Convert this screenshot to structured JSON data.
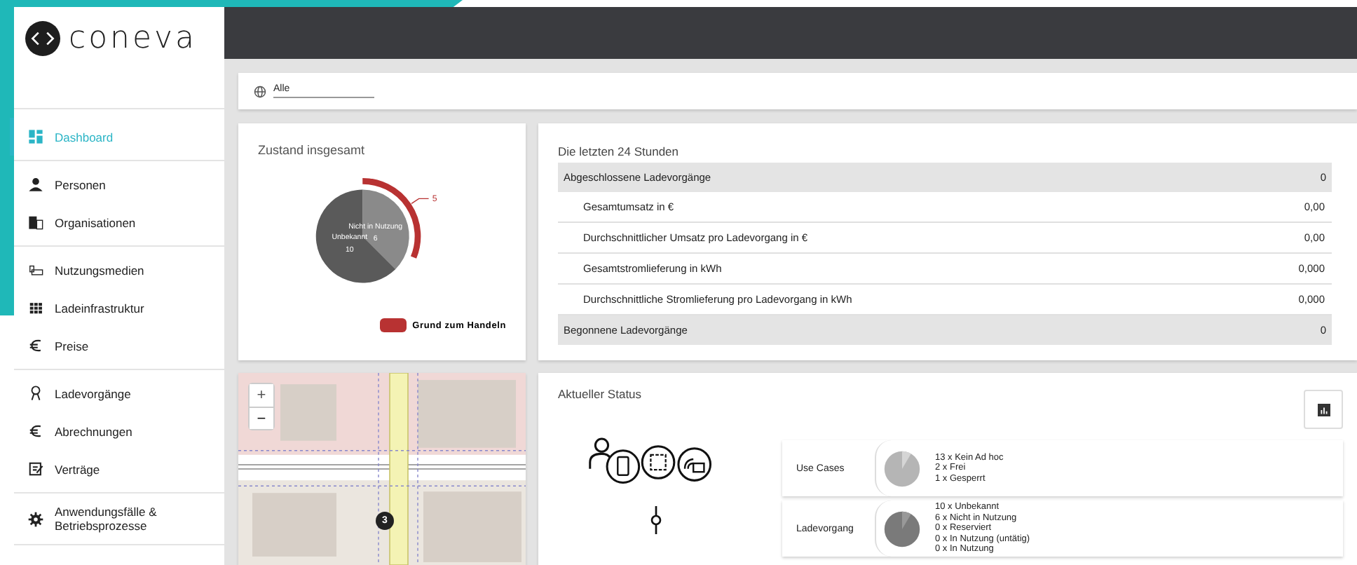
{
  "brand": {
    "name": "coneva"
  },
  "sidebar": {
    "groups": [
      {
        "items": [
          {
            "label": "Dashboard",
            "selected": true
          }
        ]
      },
      {
        "items": [
          {
            "label": "Personen",
            "selected": false
          },
          {
            "label": "Organisationen",
            "selected": false
          }
        ]
      },
      {
        "items": [
          {
            "label": "Nutzungsmedien",
            "selected": false
          },
          {
            "label": "Ladeinfrastruktur",
            "selected": false
          },
          {
            "label": "Preise",
            "selected": false
          }
        ]
      },
      {
        "items": [
          {
            "label": "Ladevorgänge",
            "selected": false
          },
          {
            "label": "Abrechnungen",
            "selected": false
          },
          {
            "label": "Verträge",
            "selected": false
          }
        ]
      },
      {
        "items": [
          {
            "label": "Anwendungsfälle & Betriebsprozesse",
            "selected": false
          }
        ]
      }
    ]
  },
  "filter": {
    "value": "Alle"
  },
  "overall_state": {
    "title": "Zustand insgesamt",
    "chart_data": {
      "type": "pie",
      "categories": [
        "Unbekannt",
        "Nicht in Nutzung"
      ],
      "values": [
        10,
        6
      ],
      "data_labels": true
    },
    "highlight": {
      "value": "5",
      "legend": "Grund zum Handeln"
    }
  },
  "last_24h": {
    "title": "Die letzten 24 Stunden",
    "rows": [
      {
        "kind": "header",
        "label": "Abgeschlossene Ladevorgänge",
        "value": "0"
      },
      {
        "kind": "sub",
        "label": "Gesamtumsatz in €",
        "value": "0,00"
      },
      {
        "kind": "sub",
        "label": "Durchschnittlicher Umsatz pro Ladevorgang in €",
        "value": "0,00"
      },
      {
        "kind": "sub",
        "label": "Gesamtstromlieferung in kWh",
        "value": "0,000"
      },
      {
        "kind": "sub",
        "label": "Durchschnittliche Stromlieferung pro Ladevorgang in kWh",
        "value": "0,000"
      },
      {
        "kind": "header",
        "label": "Begonnene Ladevorgänge",
        "value": "0"
      }
    ]
  },
  "map": {
    "zoom_in": "+",
    "zoom_out": "−",
    "cluster": "3"
  },
  "status": {
    "title": "Aktueller Status",
    "rows": [
      {
        "label": "Use Cases",
        "lines": [
          "13 x Kein Ad hoc",
          "2 x Frei",
          "1 x Gesperrt"
        ]
      },
      {
        "label": "Ladevorgang",
        "lines": [
          "10 x Unbekannt",
          "6 x Nicht in Nutzung",
          "0 x Reserviert",
          "0 x In Nutzung (untätig)",
          "0 x In Nutzung"
        ]
      }
    ]
  }
}
